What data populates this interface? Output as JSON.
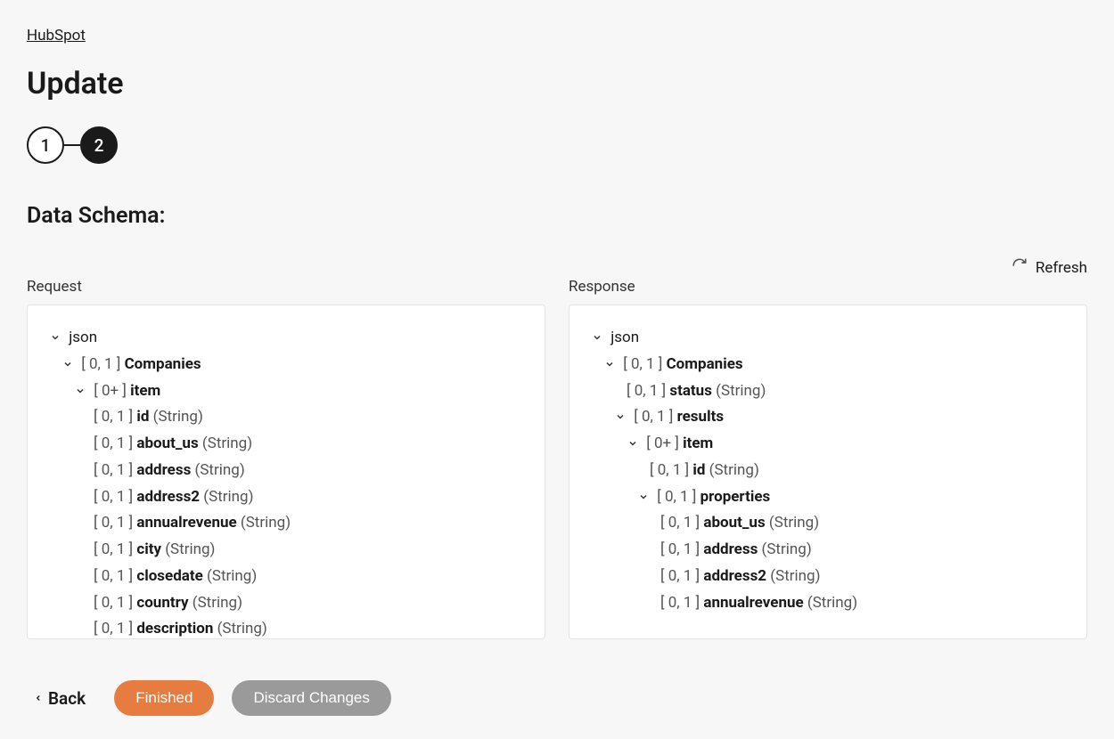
{
  "breadcrumb": "HubSpot",
  "title": "Update",
  "stepper": {
    "step1": "1",
    "step2": "2"
  },
  "section_title": "Data Schema:",
  "refresh_label": "Refresh",
  "request_label": "Request",
  "response_label": "Response",
  "tree_labels": {
    "json": "json",
    "card01": "[ 0, 1 ]",
    "card0p": "[ 0+ ]"
  },
  "request_tree": {
    "companies": "Companies",
    "item": "item",
    "fields": [
      {
        "name": "id",
        "type": "(String)"
      },
      {
        "name": "about_us",
        "type": "(String)"
      },
      {
        "name": "address",
        "type": "(String)"
      },
      {
        "name": "address2",
        "type": "(String)"
      },
      {
        "name": "annualrevenue",
        "type": "(String)"
      },
      {
        "name": "city",
        "type": "(String)"
      },
      {
        "name": "closedate",
        "type": "(String)"
      },
      {
        "name": "country",
        "type": "(String)"
      },
      {
        "name": "description",
        "type": "(String)"
      }
    ]
  },
  "response_tree": {
    "companies": "Companies",
    "status": {
      "name": "status",
      "type": "(String)"
    },
    "results": "results",
    "item": "item",
    "id": {
      "name": "id",
      "type": "(String)"
    },
    "properties": "properties",
    "fields": [
      {
        "name": "about_us",
        "type": "(String)"
      },
      {
        "name": "address",
        "type": "(String)"
      },
      {
        "name": "address2",
        "type": "(String)"
      },
      {
        "name": "annualrevenue",
        "type": "(String)"
      }
    ]
  },
  "footer": {
    "back": "Back",
    "finished": "Finished",
    "discard": "Discard Changes"
  }
}
